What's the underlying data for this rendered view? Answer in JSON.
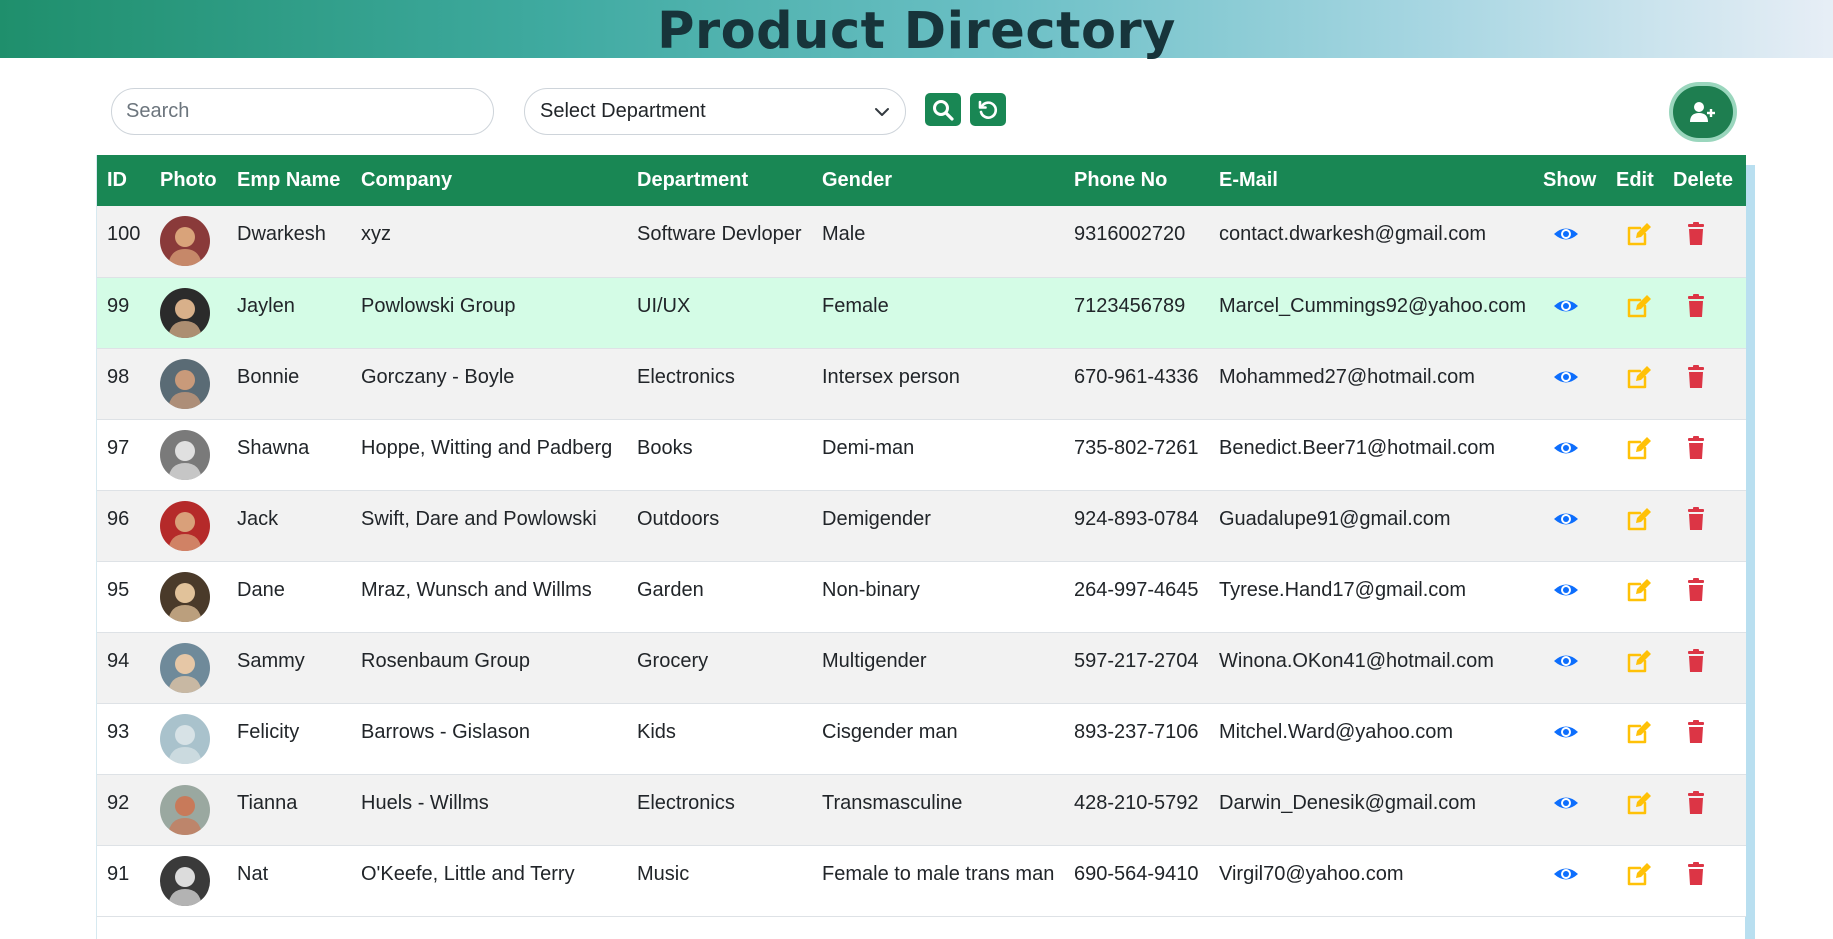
{
  "header": {
    "title": "Product Directory"
  },
  "toolbar": {
    "search_placeholder": "Search",
    "department_selected": "Select Department"
  },
  "colors": {
    "primary": "#198754",
    "show": "#0d6efd",
    "edit": "#ffc107",
    "delete": "#dc3545",
    "highlight_row": "#d4fce6"
  },
  "table": {
    "columns": [
      "ID",
      "Photo",
      "Emp Name",
      "Company",
      "Department",
      "Gender",
      "Phone No",
      "E-Mail",
      "Show",
      "Edit",
      "Delete"
    ],
    "rows": [
      {
        "id": "100",
        "name": "Dwarkesh",
        "company": "xyz",
        "department": "Software Devloper",
        "gender": "Male",
        "phone": "9316002720",
        "email": "contact.dwarkesh@gmail.com"
      },
      {
        "id": "99",
        "name": "Jaylen",
        "company": "Powlowski Group",
        "department": "UI/UX",
        "gender": "Female",
        "phone": "7123456789",
        "email": "Marcel_Cummings92@yahoo.com"
      },
      {
        "id": "98",
        "name": "Bonnie",
        "company": "Gorczany - Boyle",
        "department": "Electronics",
        "gender": "Intersex person",
        "phone": "670-961-4336",
        "email": "Mohammed27@hotmail.com"
      },
      {
        "id": "97",
        "name": "Shawna",
        "company": "Hoppe, Witting and Padberg",
        "department": "Books",
        "gender": "Demi-man",
        "phone": "735-802-7261",
        "email": "Benedict.Beer71@hotmail.com"
      },
      {
        "id": "96",
        "name": "Jack",
        "company": "Swift, Dare and Powlowski",
        "department": "Outdoors",
        "gender": "Demigender",
        "phone": "924-893-0784",
        "email": "Guadalupe91@gmail.com"
      },
      {
        "id": "95",
        "name": "Dane",
        "company": "Mraz, Wunsch and Willms",
        "department": "Garden",
        "gender": "Non-binary",
        "phone": "264-997-4645",
        "email": "Tyrese.Hand17@gmail.com"
      },
      {
        "id": "94",
        "name": "Sammy",
        "company": "Rosenbaum Group",
        "department": "Grocery",
        "gender": "Multigender",
        "phone": "597-217-2704",
        "email": "Winona.OKon41@hotmail.com"
      },
      {
        "id": "93",
        "name": "Felicity",
        "company": "Barrows - Gislason",
        "department": "Kids",
        "gender": "Cisgender man",
        "phone": "893-237-7106",
        "email": "Mitchel.Ward@yahoo.com"
      },
      {
        "id": "92",
        "name": "Tianna",
        "company": "Huels - Willms",
        "department": "Electronics",
        "gender": "Transmasculine",
        "phone": "428-210-5792",
        "email": "Darwin_Denesik@gmail.com"
      },
      {
        "id": "91",
        "name": "Nat",
        "company": "O'Keefe, Little and Terry",
        "department": "Music",
        "gender": "Female to male trans man",
        "phone": "690-564-9410",
        "email": "Virgil70@yahoo.com"
      }
    ]
  }
}
